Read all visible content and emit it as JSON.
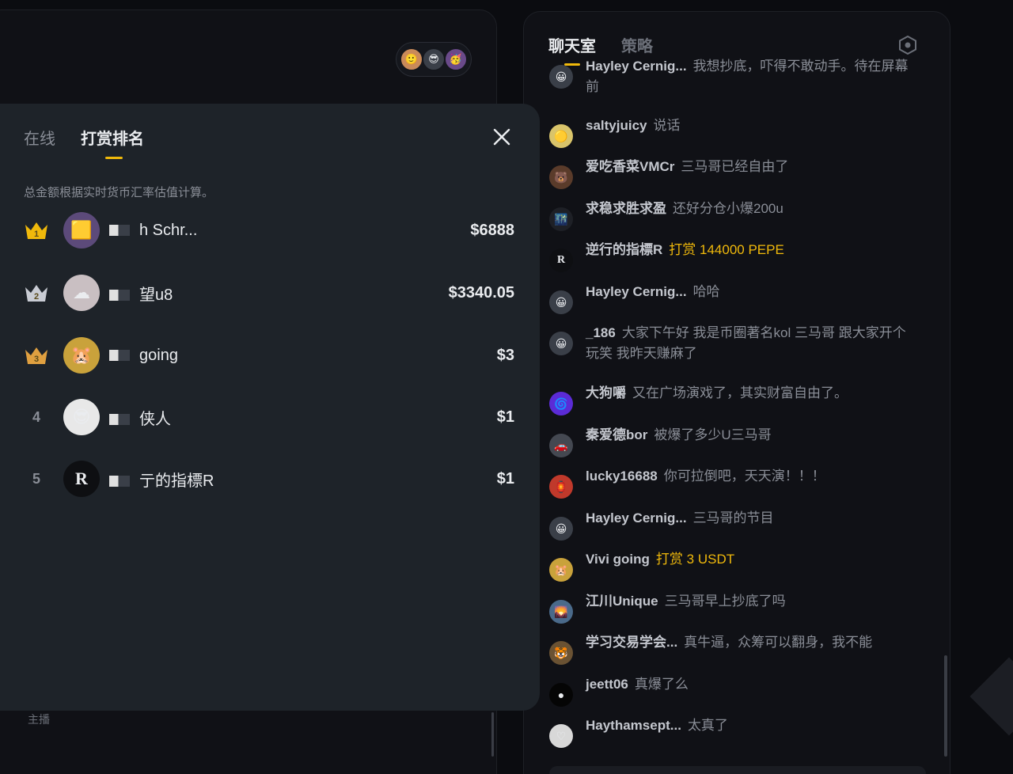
{
  "stage": {
    "host_label": "主播",
    "viewer_avatars": [
      "🙂",
      "😎",
      "🥳"
    ]
  },
  "chat": {
    "tabs": [
      {
        "label": "聊天室",
        "active": true
      },
      {
        "label": "策略",
        "active": false
      }
    ],
    "settings_icon": "hexagon-settings-icon",
    "messages": [
      {
        "user": "Hayley Cernig...",
        "text": "我想抄底，吓得不敢动手。待在屏幕前",
        "gift": false,
        "avatar": "😀",
        "avatar_bg": "#3a3f48"
      },
      {
        "user": "saltyjuicy",
        "text": "说话",
        "gift": false,
        "avatar": "🟡",
        "avatar_bg": "#d9c46a"
      },
      {
        "user": "爱吃香菜VMCr",
        "text": "三马哥已经自由了",
        "gift": false,
        "avatar": "🐻",
        "avatar_bg": "#5a3b2a"
      },
      {
        "user": "求稳求胜求盈",
        "text": "还好分仓小爆200u",
        "gift": false,
        "avatar": "🌃",
        "avatar_bg": "#1e2026"
      },
      {
        "user": "逆行的指標R",
        "text": "打赏 144000 PEPE",
        "gift": true,
        "avatar": "R",
        "avatar_bg": "#0e0f12"
      },
      {
        "user": "Hayley Cernig...",
        "text": "哈哈",
        "gift": false,
        "avatar": "😀",
        "avatar_bg": "#3a3f48"
      },
      {
        "user": "_186",
        "text": "大家下午好 我是币圈著名kol 三马哥 跟大家开个玩笑 我昨天赚麻了",
        "gift": false,
        "avatar": "😀",
        "avatar_bg": "#3a3f48"
      },
      {
        "user": "大狗嚼",
        "text": "又在广场演戏了，其实财富自由了。",
        "gift": false,
        "avatar": "🌀",
        "avatar_bg": "#5b2bd6"
      },
      {
        "user": "秦爱德bor",
        "text": "被爆了多少U三马哥",
        "gift": false,
        "avatar": "🚗",
        "avatar_bg": "#444851"
      },
      {
        "user": "lucky16688",
        "text": "你可拉倒吧，天天演！！！",
        "gift": false,
        "avatar": "🏮",
        "avatar_bg": "#c0392b"
      },
      {
        "user": "Hayley Cernig...",
        "text": "三马哥的节目",
        "gift": false,
        "avatar": "😀",
        "avatar_bg": "#3a3f48"
      },
      {
        "user": "Vivi going",
        "text": "打赏 3 USDT",
        "gift": true,
        "avatar": "🐹",
        "avatar_bg": "#c9a23b"
      },
      {
        "user": "江川Unique",
        "text": "三马哥早上抄底了吗",
        "gift": false,
        "avatar": "🌄",
        "avatar_bg": "#4a6a8a"
      },
      {
        "user": "学习交易学会...",
        "text": "真牛逼，众筹可以翻身，我不能",
        "gift": false,
        "avatar": "🐯",
        "avatar_bg": "#6a5233"
      },
      {
        "user": "jeett06",
        "text": "真爆了么",
        "gift": false,
        "avatar": "●",
        "avatar_bg": "#050505"
      },
      {
        "user": "Haythamsept...",
        "text": "太真了",
        "gift": false,
        "avatar": "♡",
        "avatar_bg": "#d8d8d8"
      }
    ]
  },
  "modal": {
    "tabs": [
      {
        "label": "在线",
        "active": false
      },
      {
        "label": "打赏排名",
        "active": true
      }
    ],
    "close_icon": "close-icon",
    "note": "总金额根据实时货币汇率估值计算。",
    "ranking": [
      {
        "rank": "1",
        "name": "h Schr...",
        "amount": "$6888",
        "avatar": "🟨",
        "avatar_bg": "#5c4a7a",
        "badge": "gold"
      },
      {
        "rank": "2",
        "name": "望u8",
        "amount": "$3340.05",
        "avatar": "☁",
        "avatar_bg": "#c9bfc2",
        "badge": "silver"
      },
      {
        "rank": "3",
        "name": "going",
        "amount": "$3",
        "avatar": "🐹",
        "avatar_bg": "#c9a23b",
        "badge": "bronze"
      },
      {
        "rank": "4",
        "name": "侠人",
        "amount": "$1",
        "avatar": "😎",
        "avatar_bg": "#e8e8e8",
        "badge": "none"
      },
      {
        "rank": "5",
        "name": "亍的指標R",
        "amount": "$1",
        "avatar": "R",
        "avatar_bg": "#0e0f12",
        "badge": "none"
      }
    ]
  }
}
